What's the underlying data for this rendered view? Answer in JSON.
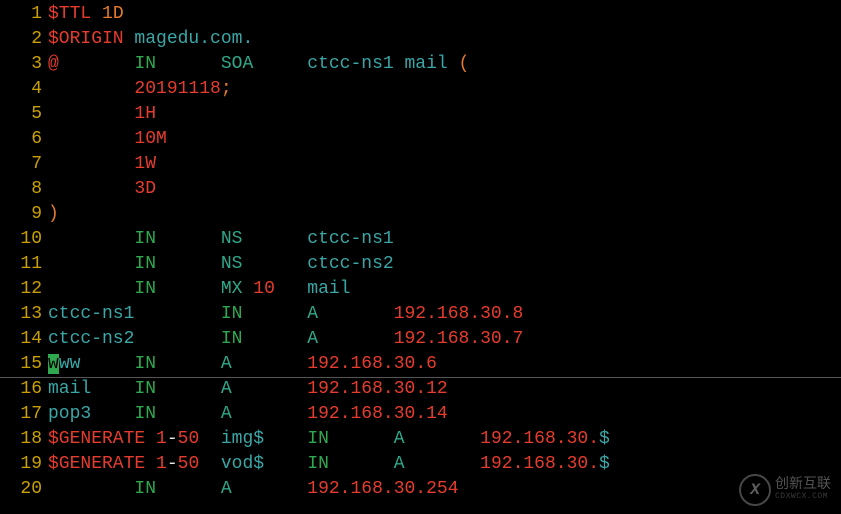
{
  "lines": [
    {
      "n": "1",
      "spans": [
        [
          "red",
          "$TTL "
        ],
        [
          "orange",
          "1D"
        ]
      ]
    },
    {
      "n": "2",
      "spans": [
        [
          "red",
          "$ORIGIN "
        ],
        [
          "cyan",
          "magedu.com."
        ]
      ]
    },
    {
      "n": "3",
      "spans": [
        [
          "red",
          "@"
        ],
        [
          "white",
          "       "
        ],
        [
          "green",
          "IN"
        ],
        [
          "white",
          "      "
        ],
        [
          "teal",
          "SOA"
        ],
        [
          "white",
          "     "
        ],
        [
          "cyan",
          "ctcc-ns1 mail "
        ],
        [
          "orange",
          "("
        ]
      ]
    },
    {
      "n": "4",
      "spans": [
        [
          "white",
          "        "
        ],
        [
          "red",
          "20191118"
        ],
        [
          "orange",
          ";"
        ]
      ]
    },
    {
      "n": "5",
      "spans": [
        [
          "white",
          "        "
        ],
        [
          "red",
          "1H"
        ]
      ]
    },
    {
      "n": "6",
      "spans": [
        [
          "white",
          "        "
        ],
        [
          "red",
          "10M"
        ]
      ]
    },
    {
      "n": "7",
      "spans": [
        [
          "white",
          "        "
        ],
        [
          "red",
          "1W"
        ]
      ]
    },
    {
      "n": "8",
      "spans": [
        [
          "white",
          "        "
        ],
        [
          "red",
          "3D"
        ]
      ]
    },
    {
      "n": "9",
      "spans": [
        [
          "orange",
          ")"
        ]
      ]
    },
    {
      "n": "10",
      "spans": [
        [
          "white",
          "        "
        ],
        [
          "green",
          "IN"
        ],
        [
          "white",
          "      "
        ],
        [
          "teal",
          "NS"
        ],
        [
          "white",
          "      "
        ],
        [
          "cyan",
          "ctcc-ns1"
        ]
      ]
    },
    {
      "n": "11",
      "spans": [
        [
          "white",
          "        "
        ],
        [
          "green",
          "IN"
        ],
        [
          "white",
          "      "
        ],
        [
          "teal",
          "NS"
        ],
        [
          "white",
          "      "
        ],
        [
          "cyan",
          "ctcc-ns2"
        ]
      ]
    },
    {
      "n": "12",
      "spans": [
        [
          "white",
          "        "
        ],
        [
          "green",
          "IN"
        ],
        [
          "white",
          "      "
        ],
        [
          "teal",
          "MX"
        ],
        [
          "white",
          " "
        ],
        [
          "red",
          "10"
        ],
        [
          "white",
          "   "
        ],
        [
          "cyan",
          "mail"
        ]
      ]
    },
    {
      "n": "13",
      "spans": [
        [
          "cyan",
          "ctcc-ns1"
        ],
        [
          "white",
          "        "
        ],
        [
          "green",
          "IN"
        ],
        [
          "white",
          "      "
        ],
        [
          "teal",
          "A"
        ],
        [
          "white",
          "       "
        ],
        [
          "red",
          "192.168.30.8"
        ]
      ]
    },
    {
      "n": "14",
      "spans": [
        [
          "cyan",
          "ctcc-ns2"
        ],
        [
          "white",
          "        "
        ],
        [
          "green",
          "IN"
        ],
        [
          "white",
          "      "
        ],
        [
          "teal",
          "A"
        ],
        [
          "white",
          "       "
        ],
        [
          "red",
          "192.168.30.7"
        ]
      ]
    },
    {
      "n": "15",
      "spans": [
        [
          "cyan",
          "www"
        ],
        [
          "white",
          "     "
        ],
        [
          "green",
          "IN"
        ],
        [
          "white",
          "      "
        ],
        [
          "teal",
          "A"
        ],
        [
          "white",
          "       "
        ],
        [
          "red",
          "192.168.30.6"
        ]
      ],
      "cursor_at": 0
    },
    {
      "n": "16",
      "spans": [
        [
          "cyan",
          "mail"
        ],
        [
          "white",
          "    "
        ],
        [
          "green",
          "IN"
        ],
        [
          "white",
          "      "
        ],
        [
          "teal",
          "A"
        ],
        [
          "white",
          "       "
        ],
        [
          "red",
          "192.168.30.12"
        ]
      ]
    },
    {
      "n": "17",
      "spans": [
        [
          "cyan",
          "pop3"
        ],
        [
          "white",
          "    "
        ],
        [
          "green",
          "IN"
        ],
        [
          "white",
          "      "
        ],
        [
          "teal",
          "A"
        ],
        [
          "white",
          "       "
        ],
        [
          "red",
          "192.168.30.14"
        ]
      ]
    },
    {
      "n": "18",
      "spans": [
        [
          "red",
          "$GENERATE "
        ],
        [
          "red",
          "1"
        ],
        [
          "white",
          "-"
        ],
        [
          "red",
          "50"
        ],
        [
          "white",
          "  "
        ],
        [
          "cyan",
          "img$"
        ],
        [
          "white",
          "    "
        ],
        [
          "green",
          "IN"
        ],
        [
          "white",
          "      "
        ],
        [
          "teal",
          "A"
        ],
        [
          "white",
          "       "
        ],
        [
          "red",
          "192.168.30."
        ],
        [
          "cyan",
          "$"
        ]
      ]
    },
    {
      "n": "19",
      "spans": [
        [
          "red",
          "$GENERATE "
        ],
        [
          "red",
          "1"
        ],
        [
          "white",
          "-"
        ],
        [
          "red",
          "50"
        ],
        [
          "white",
          "  "
        ],
        [
          "cyan",
          "vod$"
        ],
        [
          "white",
          "    "
        ],
        [
          "green",
          "IN"
        ],
        [
          "white",
          "      "
        ],
        [
          "teal",
          "A"
        ],
        [
          "white",
          "       "
        ],
        [
          "red",
          "192.168.30."
        ],
        [
          "cyan",
          "$"
        ]
      ]
    },
    {
      "n": "20",
      "spans": [
        [
          "white",
          "        "
        ],
        [
          "green",
          "IN"
        ],
        [
          "white",
          "      "
        ],
        [
          "teal",
          "A"
        ],
        [
          "white",
          "       "
        ],
        [
          "red",
          "192.168.30.254"
        ]
      ]
    }
  ],
  "hr_after_line": 15,
  "watermark": {
    "logo": "X",
    "cn": "创新互联",
    "en": "CDXWCX.COM"
  }
}
